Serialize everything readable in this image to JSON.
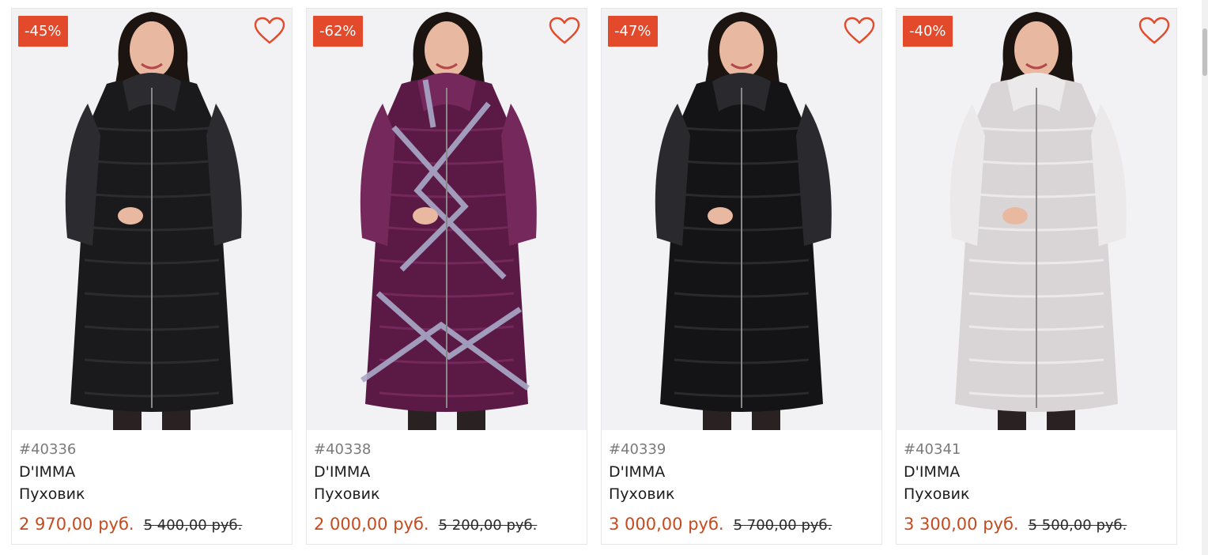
{
  "accent_color": "#e34a2b",
  "price_color": "#c64a1e",
  "products": [
    {
      "discount": "-45%",
      "sku": "#40336",
      "brand": "D'IMMA",
      "type": "Пуховик",
      "price": "2 970,00 руб.",
      "old_price": "5 400,00 руб.",
      "coat_color": "#1a1a1c",
      "coat_shade": "#2c2c30",
      "stripe_color": "",
      "fav_icon": "heart-outline-icon"
    },
    {
      "discount": "-62%",
      "sku": "#40338",
      "brand": "D'IMMA",
      "type": "Пуховик",
      "price": "2 000,00 руб.",
      "old_price": "5 200,00 руб.",
      "coat_color": "#5a1a45",
      "coat_shade": "#74285c",
      "stripe_color": "#a9a9c9",
      "fav_icon": "heart-outline-icon"
    },
    {
      "discount": "-47%",
      "sku": "#40339",
      "brand": "D'IMMA",
      "type": "Пуховик",
      "price": "3 000,00 руб.",
      "old_price": "5 700,00 руб.",
      "coat_color": "#141416",
      "coat_shade": "#2a2a2e",
      "stripe_color": "",
      "fav_icon": "heart-outline-icon"
    },
    {
      "discount": "-40%",
      "sku": "#40341",
      "brand": "D'IMMA",
      "type": "Пуховик",
      "price": "3 300,00 руб.",
      "old_price": "5 500,00 руб.",
      "coat_color": "#d9d5d6",
      "coat_shade": "#ece9ea",
      "stripe_color": "",
      "fav_icon": "heart-outline-icon"
    }
  ]
}
